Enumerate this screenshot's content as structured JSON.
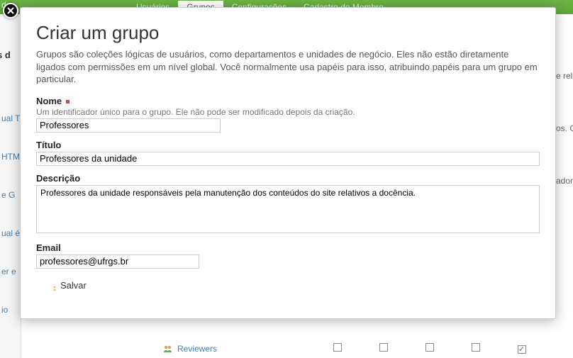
{
  "header": {
    "left_text": "d     e",
    "tabs": [
      {
        "label": "Usuários",
        "active": false
      },
      {
        "label": "Grupos",
        "active": true
      },
      {
        "label": "Configurações",
        "active": false
      },
      {
        "label": "Cadastro de Membro",
        "active": false
      }
    ]
  },
  "sidebar": {
    "top_text": "s d",
    "items": [
      "ual T",
      "HTM",
      "e G",
      "ual é",
      "er e",
      "io"
    ]
  },
  "right_edge": {
    "items": [
      "e rela",
      "os. C",
      "adors"
    ]
  },
  "modal": {
    "title": "Criar um grupo",
    "description": "Grupos são coleções lógicas de usuários, como departamentos e unidades de negócio. Eles não estão diretamente ligados com permissões em um nível global. Você normalmente usa papéis para isso, atribuindo papéis para um grupo em particular.",
    "fields": {
      "name": {
        "label": "Nome",
        "required": true,
        "help": "Um identificador único para o grupo. Ele não pode ser modificado depois da criação.",
        "value": "Professores"
      },
      "title": {
        "label": "Título",
        "value": "Professores da unidade"
      },
      "description_field": {
        "label": "Descrição",
        "value": "Professores da unidade responsáveis pela manutenção dos conteúdos do site relativos a docência."
      },
      "email": {
        "label": "Email",
        "value": "professores@ufrgs.br"
      }
    },
    "save_label": "Salvar"
  },
  "bottom": {
    "group": "Reviewers",
    "checks": [
      false,
      false,
      false,
      false,
      true
    ]
  }
}
